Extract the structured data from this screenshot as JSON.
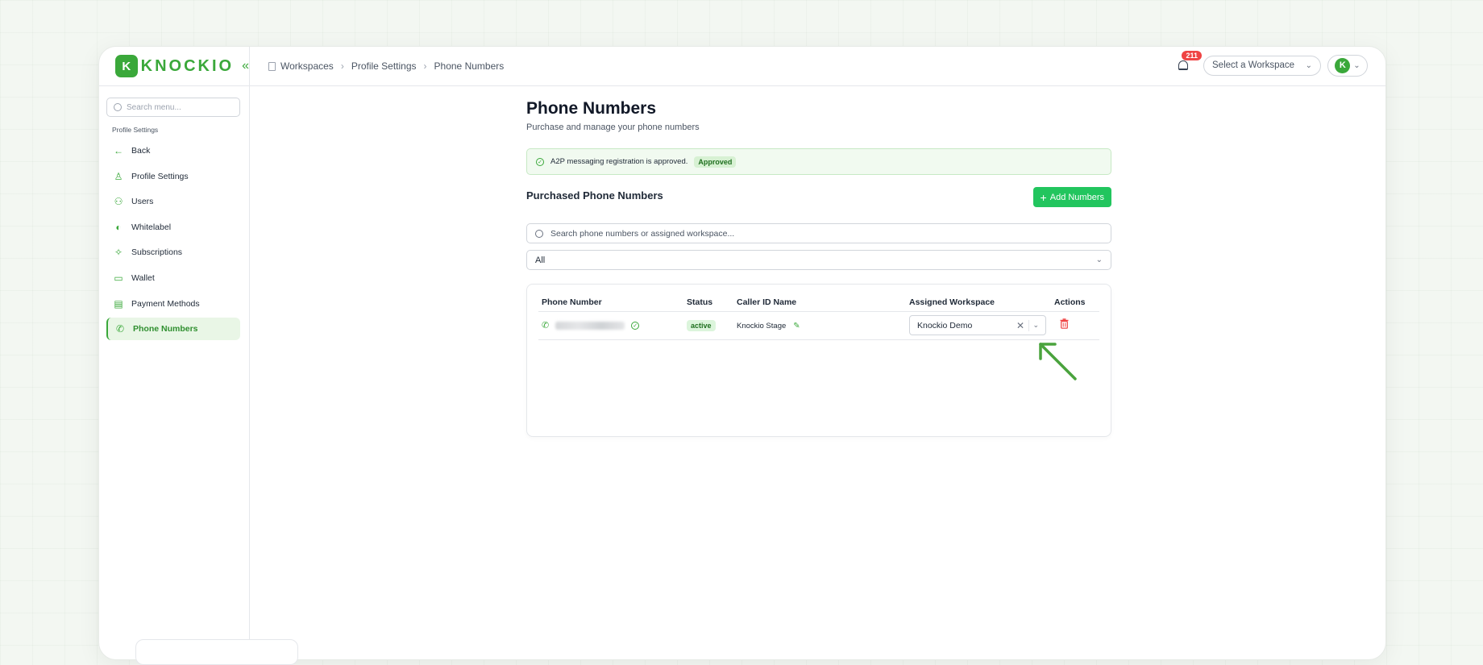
{
  "brand": {
    "logo_letter": "K",
    "name": "KNOCKIO",
    "collapse_glyph": "«"
  },
  "breadcrumb": [
    "Workspaces",
    "Profile Settings",
    "Phone Numbers"
  ],
  "header": {
    "notification_count": "211",
    "workspace_select_placeholder": "Select a Workspace",
    "avatar_letter": "K"
  },
  "sidebar": {
    "search_placeholder": "Search menu...",
    "section_label": "Profile Settings",
    "items": [
      {
        "label": "Back",
        "icon": "arrow-left-icon"
      },
      {
        "label": "Profile Settings",
        "icon": "user-icon"
      },
      {
        "label": "Users",
        "icon": "users-icon"
      },
      {
        "label": "Whitelabel",
        "icon": "palette-icon"
      },
      {
        "label": "Subscriptions",
        "icon": "sparkles-icon"
      },
      {
        "label": "Wallet",
        "icon": "wallet-icon"
      },
      {
        "label": "Payment Methods",
        "icon": "credit-card-icon"
      },
      {
        "label": "Phone Numbers",
        "icon": "phone-icon",
        "active": true
      }
    ]
  },
  "main": {
    "title": "Phone Numbers",
    "subtitle": "Purchase and manage your phone numbers",
    "alert": {
      "text": "A2P messaging registration is approved.",
      "badge": "Approved"
    },
    "section_title": "Purchased Phone Numbers",
    "add_button": "Add Numbers",
    "search_placeholder": "Search phone numbers or assigned workspace...",
    "filter_value": "All",
    "table": {
      "headers": [
        "Phone Number",
        "Status",
        "Caller ID Name",
        "Assigned Workspace",
        "Actions"
      ],
      "rows": [
        {
          "status": "active",
          "caller_id": "Knockio Stage",
          "workspace": "Knockio Demo"
        }
      ]
    }
  },
  "colors": {
    "accent": "#3aa83a",
    "button": "#22c55e",
    "danger": "#ef4444"
  }
}
